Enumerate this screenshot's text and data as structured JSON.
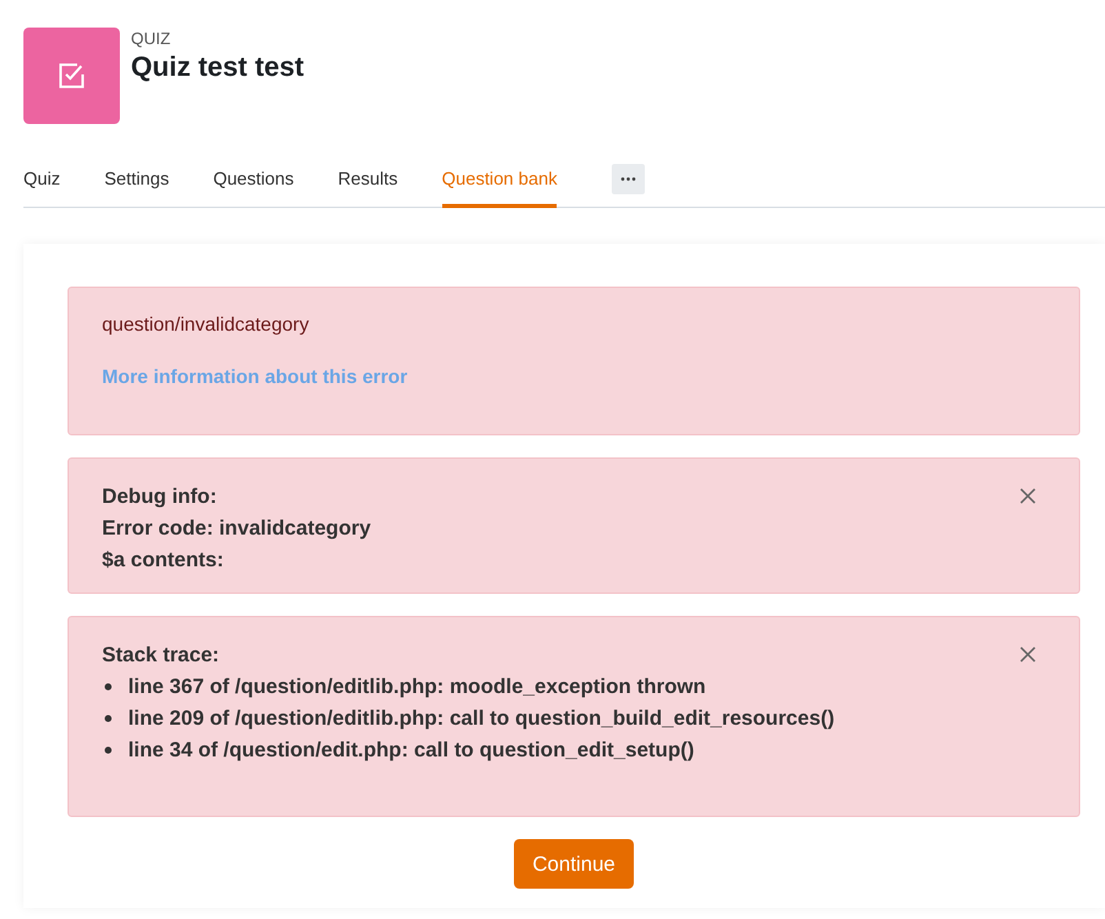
{
  "header": {
    "kicker": "QUIZ",
    "title": "Quiz test test"
  },
  "tabs": [
    {
      "label": "Quiz",
      "selected": false
    },
    {
      "label": "Settings",
      "selected": false
    },
    {
      "label": "Questions",
      "selected": false
    },
    {
      "label": "Results",
      "selected": false
    },
    {
      "label": "Question bank",
      "selected": true
    }
  ],
  "error": {
    "message": "question/invalidcategory",
    "link": "More information about this error"
  },
  "debug": {
    "lines": [
      "Debug info:",
      "Error code: invalidcategory",
      "$a contents:"
    ]
  },
  "stack": {
    "heading": "Stack trace:",
    "items": [
      "line 367 of /question/editlib.php: moodle_exception thrown",
      "line 209 of /question/editlib.php: call to question_build_edit_resources()",
      "line 34 of /question/edit.php: call to question_edit_setup()"
    ]
  },
  "button": "Continue"
}
